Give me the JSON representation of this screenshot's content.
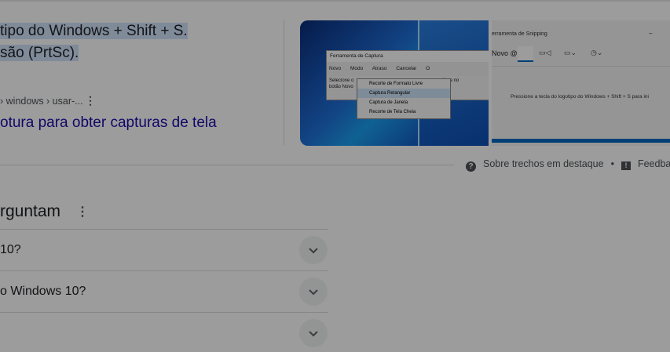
{
  "snippet": {
    "line1": "tipo do Windows + Shift + S.",
    "line2": "são (PrtSc)."
  },
  "result": {
    "breadcrumb": "› windows › usar-...",
    "more_icon": "more-vert-icon",
    "link": "otura para obter capturas de tela"
  },
  "image1": {
    "window_title": "Ferramenta de Captura",
    "tool_novo": "Novo",
    "tool_modo": "Modo",
    "tool_atraso": "Atraso",
    "tool_cancelar": "Cancelar",
    "tool_opcoes": "O",
    "desc_line1": "Selecione o",
    "desc_line1b": "ou clique no",
    "desc_line2": "botão Novo",
    "menu": [
      "Recorte de Formato Livre",
      "Captura Retangular",
      "Captura de Janela",
      "Recorte de Tela Cheia"
    ],
    "menu_selected_index": 1
  },
  "image2": {
    "window_title": "erramenta de Snipping",
    "novo_label": "Novo",
    "press_text": "Pressione a tecla do logotipo do Windows + Shift + S para ini"
  },
  "about": {
    "label": "Sobre trechos em destaque",
    "separator": "•",
    "feedback": "Feedba"
  },
  "paa": {
    "title": "rguntam",
    "questions": [
      "10?",
      "o Windows 10?",
      ""
    ]
  },
  "colors": {
    "link": "#1a0dab",
    "highlight": "#d2e3fc",
    "overlay": "rgba(0,0,0,0.39)"
  }
}
